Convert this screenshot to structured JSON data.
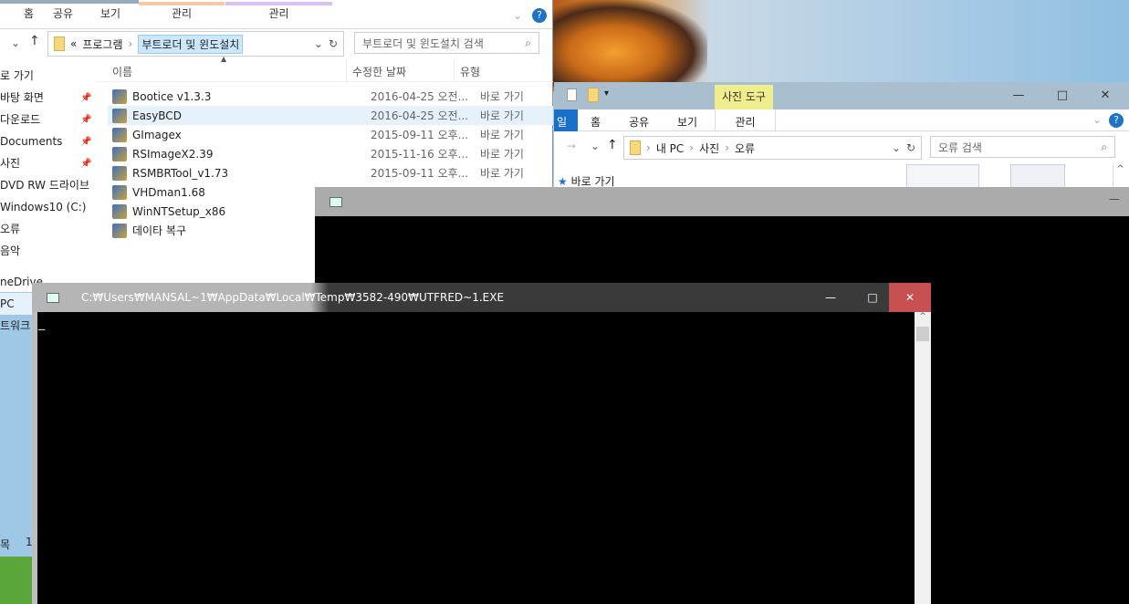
{
  "explorer_left": {
    "tabs": [
      "홈",
      "공유",
      "보기",
      "관리",
      "관리"
    ],
    "breadcrumb": [
      "«",
      "프로그램",
      "부트로더 및 윈도설치"
    ],
    "search_placeholder": "부트로더 및 윈도설치 검색",
    "nav": [
      "로 가기",
      "바탕 화면",
      "다운로드",
      "Documents",
      "사진",
      "DVD RW 드라이브",
      "Windows10 (C:)",
      "오류",
      "음악",
      "neDrive",
      "PC",
      "트워크"
    ],
    "columns": [
      "이름",
      "수정한 날짜",
      "유형"
    ],
    "files": [
      {
        "name": "Bootice v1.3.3",
        "date": "2016-04-25 오전...",
        "type": "바로 가기"
      },
      {
        "name": "EasyBCD",
        "date": "2016-04-25 오전...",
        "type": "바로 가기"
      },
      {
        "name": "GImagex",
        "date": "2015-09-11 오후...",
        "type": "바로 가기"
      },
      {
        "name": "RSImageX2.39",
        "date": "2015-11-16 오후...",
        "type": "바로 가기"
      },
      {
        "name": "RSMBRTool_v1.73",
        "date": "2015-09-11 오후...",
        "type": "바로 가기"
      },
      {
        "name": "VHDman1.68",
        "date": "",
        "type": ""
      },
      {
        "name": "WinNTSetup_x86",
        "date": "",
        "type": ""
      },
      {
        "name": "데이타 복구",
        "date": "",
        "type": ""
      }
    ],
    "status": [
      "목",
      "1"
    ]
  },
  "explorer_right": {
    "context_tab": "사진 도구",
    "tabs": [
      "일",
      "홈",
      "공유",
      "보기",
      "관리"
    ],
    "breadcrumb": [
      "내 PC",
      "사진",
      "오류"
    ],
    "search_placeholder": "오류 검색",
    "nav": [
      "바로 가기"
    ]
  },
  "console_back": {
    "title": "C:\\Users\\MANSAL~1\\AppData\\Local\\Temp\\3582-490\\UTFRED~1.EXE"
  },
  "console_front": {
    "title": "C:₩Users₩MANSAL~1₩AppData₩Local₩Temp₩3582-490₩UTFRED~1.EXE",
    "cursor": "_"
  },
  "window_buttons": {
    "minimize": "—",
    "maximize": "□",
    "close": "✕"
  }
}
